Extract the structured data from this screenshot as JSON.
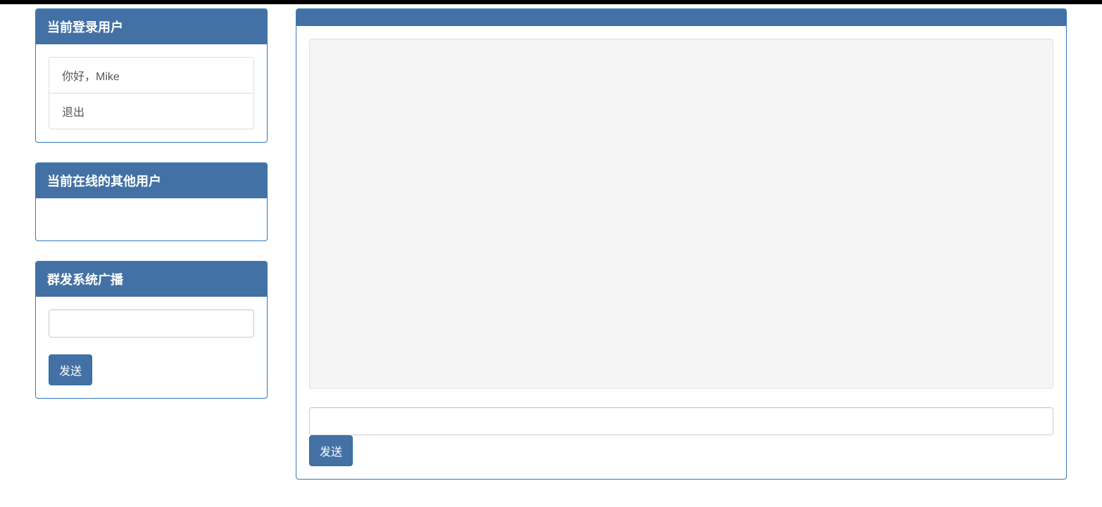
{
  "sidebar": {
    "current_user_panel": {
      "title": "当前登录用户",
      "greeting": "你好，Mike",
      "logout_label": "退出"
    },
    "online_users_panel": {
      "title": "当前在线的其他用户"
    },
    "broadcast_panel": {
      "title": "群发系统广播",
      "input_value": "",
      "send_label": "发送"
    }
  },
  "chat": {
    "header": "",
    "messages": "",
    "input_value": "",
    "send_label": "发送"
  }
}
